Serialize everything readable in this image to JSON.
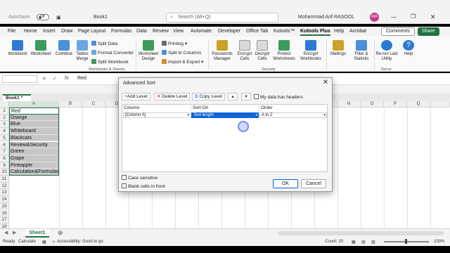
{
  "titlebar": {
    "autosave": "AutoSave",
    "autosave_state": "Off",
    "filename": "Book1",
    "search_placeholder": "Search (Alt+Q)",
    "user_name": "Mohammad Arif RASOOL",
    "avatar_initials": "MA"
  },
  "menu": {
    "tabs": [
      "File",
      "Home",
      "Insert",
      "Draw",
      "Page Layout",
      "Formulas",
      "Data",
      "Review",
      "View",
      "Automate",
      "Developer",
      "Office Tab",
      "Kutools™",
      "Kutools Plus",
      "Help",
      "Acrobat"
    ],
    "active_tab": "Kutools Plus",
    "comments_label": "Comments",
    "share_label": "Share"
  },
  "ribbon": {
    "workbook": "Workbook",
    "worksheet": "Worksheet",
    "combine": "Combine",
    "tables_merge": "Tables Merge",
    "split_data": "Split Data",
    "format_converter": "Format Converter",
    "split_workbook": "Split Workbook",
    "group_workbooks": "Workbooks & Sheets",
    "worksheet_design": "Worksheet Design",
    "printing": "Printing",
    "split_to_columns": "Split to Columns",
    "import_export": "Import & Export",
    "passwords_manager": "Passwords Manager",
    "encrypt_cells": "Encrypt Cells",
    "decrypt_cells": "Decrypt Cells",
    "protect_worksheets": "Protect Worksheets",
    "encrypt_workbooks": "Encrypt Workbooks",
    "group_security": "Security",
    "mailings": "Mailings",
    "filter_statistic": "Filter & Statistic",
    "rerun": "Re-run Last Utility",
    "help": "Help",
    "group_rerun": "Rerun"
  },
  "formula_bar": {
    "name_box": "",
    "fx": "fx",
    "value": "Red"
  },
  "workbook_tab": "Book1 *",
  "grid": {
    "columns": [
      "A",
      "B",
      "C",
      "D",
      "E",
      "F",
      "G",
      "H",
      "I",
      "J",
      "K",
      "L",
      "M",
      "N",
      "O",
      "P",
      "Q"
    ],
    "row_numbers": [
      "1",
      "2",
      "3",
      "4",
      "5",
      "6",
      "7",
      "8",
      "9",
      "10",
      "11",
      "12",
      "13",
      "14",
      "15",
      "16",
      "17",
      "18"
    ],
    "column_a_values": [
      "Red",
      "Orange",
      "Blue",
      "Whiteboard",
      "Blackcats",
      "Review&Security",
      "Green",
      "Grape",
      "Pineapple",
      "Calculation&Formulas"
    ]
  },
  "sheet_tab": "Sheet1",
  "status": {
    "ready": "Ready",
    "calculate": "Calculate",
    "accessibility": "Accessibility: Good to go",
    "count": "Count: 10",
    "zoom": "100%"
  },
  "dialog": {
    "title": "Advanced Sort",
    "add_level": "Add Level",
    "delete_level": "Delete Level",
    "copy_level": "Copy Level",
    "my_data_has_headers": "My data has headers",
    "headers": {
      "column": "Column",
      "sort_on": "Sort On",
      "order": "Order"
    },
    "row": {
      "column": "[Column A]",
      "sort_on": "Text length",
      "order": "A to Z"
    },
    "case_sensitive": "Case sensitive",
    "blank_cells_in_front": "Blank cells in front",
    "ok": "OK",
    "cancel": "Cancel"
  },
  "colors": {
    "excel_green": "#217346",
    "selection_blue": "#0a64d6",
    "share_green": "#1e7145"
  }
}
